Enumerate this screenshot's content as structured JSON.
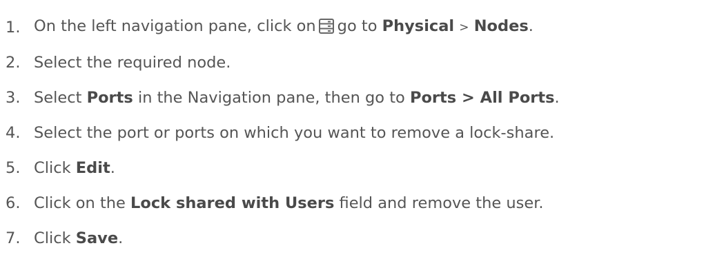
{
  "steps": [
    {
      "number": "1.",
      "text_before": "On the left navigation pane, click on",
      "icon": "server-icon",
      "text_mid": "go to",
      "bold_a": "Physical",
      "separator": ">",
      "bold_b": "Nodes",
      "text_after": "."
    },
    {
      "number": "2.",
      "text": "Select the required node."
    },
    {
      "number": "3.",
      "text_before": "Select",
      "bold_a": "Ports",
      "text_mid": "in the Navigation pane, then go to",
      "bold_b": "Ports > All Ports",
      "text_after": "."
    },
    {
      "number": "4.",
      "text": "Select the port or ports on which you want to remove a lock-share."
    },
    {
      "number": "5.",
      "text_before": "Click",
      "bold_a": "Edit",
      "text_after": "."
    },
    {
      "number": "6.",
      "text_before": "Click on the",
      "bold_a": "Lock shared with Users",
      "text_after": "field and remove the user."
    },
    {
      "number": "7.",
      "text_before": "Click",
      "bold_a": "Save",
      "text_after": "."
    }
  ],
  "colors": {
    "text": "#555555",
    "icon": "#666666"
  }
}
